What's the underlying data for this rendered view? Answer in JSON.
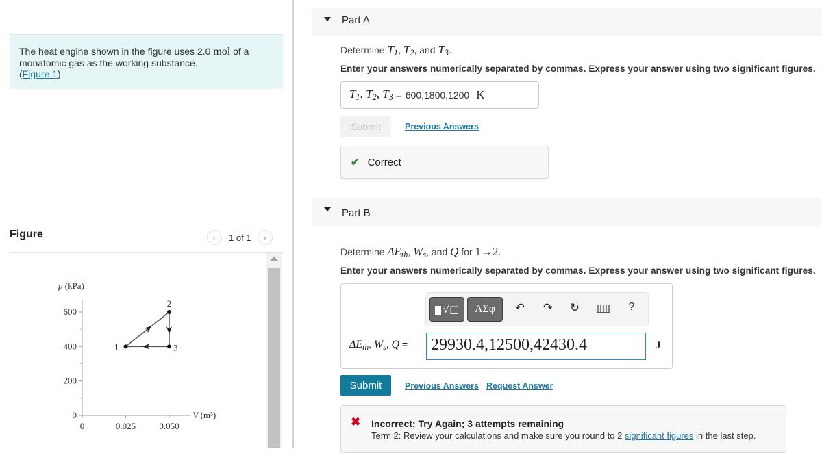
{
  "intro": {
    "text_before": "The heat engine shown in the figure uses 2.0 ",
    "unit": "mol",
    "text_after": " of a monatomic gas as the working substance.",
    "figure_link_open": "(",
    "figure_link": "Figure 1",
    "figure_link_close": ")"
  },
  "figure_panel": {
    "title": "Figure",
    "pager_text": "1 of 1",
    "prev_icon": "chevron-left-icon",
    "next_icon": "chevron-right-icon"
  },
  "chart_data": {
    "type": "line",
    "title": "",
    "xlabel": "V (m³)",
    "ylabel": "p (kPa)",
    "xlim": [
      0,
      0.06
    ],
    "ylim": [
      0,
      650
    ],
    "x_ticks": [
      0,
      0.025,
      0.05
    ],
    "x_tick_labels": [
      "0",
      "0.025",
      "0.050"
    ],
    "y_ticks": [
      0,
      200,
      400,
      600
    ],
    "y_tick_labels": [
      "0",
      "200",
      "400",
      "600"
    ],
    "y_minor_ticks": [
      100,
      300,
      500
    ],
    "grid": false,
    "points": [
      {
        "label": "1",
        "x": 0.025,
        "y": 400
      },
      {
        "label": "2",
        "x": 0.05,
        "y": 600
      },
      {
        "label": "3",
        "x": 0.05,
        "y": 400
      }
    ],
    "cycle": [
      "1",
      "2",
      "3",
      "1"
    ]
  },
  "partA": {
    "title": "Part A",
    "question_prefix": "Determine ",
    "q_vars": [
      "T",
      "1",
      "T",
      "2",
      "T",
      "3"
    ],
    "question_and": ", and ",
    "instructions": "Enter your answers numerically separated by commas. Express your answer using two significant figures.",
    "answer_label_sep": " = ",
    "answer_value": "600,1800,1200",
    "answer_unit": "K",
    "submit_label": "Submit",
    "previous_answers": "Previous Answers",
    "feedback": "Correct"
  },
  "partB": {
    "title": "Part B",
    "question_prefix": "Determine ",
    "q_delta_e": "ΔE",
    "q_th": "th",
    "q_w": "W",
    "q_s": "s",
    "question_and": ", and ",
    "q_q": "Q",
    "question_for": " for ",
    "question_process": "1→2",
    "instructions": "Enter your answers numerically separated by commas. Express your answer using two significant figures.",
    "toolbar": {
      "templates_icon": "templates-icon",
      "greek_label": "ΑΣφ",
      "undo_icon": "undo-icon",
      "redo_icon": "redo-icon",
      "reset_icon": "reset-icon",
      "keyboard_icon": "keyboard-icon",
      "help_label": "?"
    },
    "answer_label_eq": " =",
    "answer_value": "29930.4,12500,42430.4",
    "answer_unit": "J",
    "submit_label": "Submit",
    "previous_answers": "Previous Answers",
    "request_answer": "Request Answer",
    "feedback_title": "Incorrect; Try Again; 3 attempts remaining",
    "feedback_msg_before": "Term 2: Review your calculations and make sure you round to 2 ",
    "feedback_link": "significant figures",
    "feedback_msg_after": " in the last step."
  }
}
